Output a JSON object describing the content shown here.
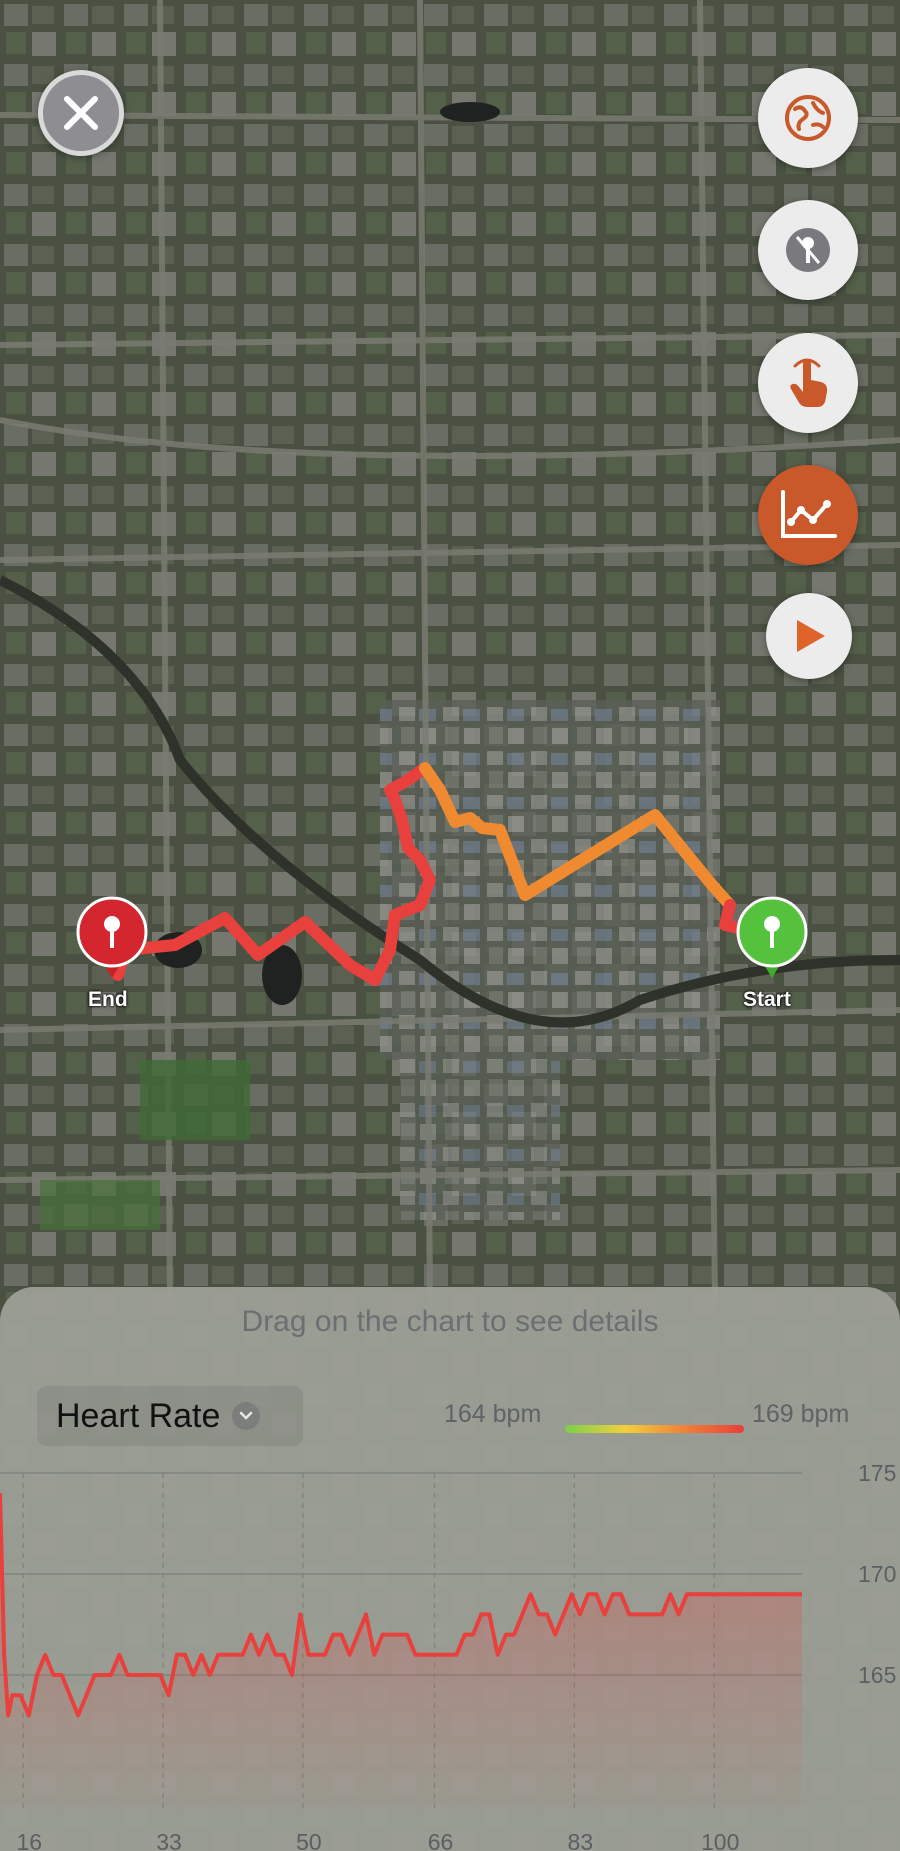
{
  "map": {
    "start_label": "Start",
    "end_label": "End",
    "route_colors": {
      "high": "#e8403d",
      "mid": "#f08a30",
      "low": "#7bd04a"
    }
  },
  "controls": {
    "close_icon": "close-icon",
    "globe_icon": "globe-icon",
    "pin_icon": "pin-hide-icon",
    "touch_icon": "touch-icon",
    "chart_icon": "chart-line-icon",
    "play_icon": "play-icon",
    "accent": "#c9582a"
  },
  "panel": {
    "hint": "Drag on the chart to see details",
    "metric": "Heart Rate",
    "legend_min": "164 bpm",
    "legend_max": "169 bpm"
  },
  "chart_data": {
    "type": "line",
    "metric": "Heart Rate",
    "unit": "bpm",
    "x_ticks": [
      16,
      33,
      50,
      66,
      83,
      100
    ],
    "y_ticks": [
      165,
      170,
      175
    ],
    "xlim": [
      10.5,
      108
    ],
    "ylim": [
      160.3,
      175
    ],
    "grid": true,
    "series": [
      {
        "color": "#e8403d",
        "x": [
          10.5,
          11,
          11.5,
          12,
          13,
          14,
          15,
          16,
          17,
          18,
          19,
          20,
          21,
          22,
          23,
          24,
          25,
          26,
          27,
          28,
          29,
          30,
          31,
          32,
          33,
          34,
          35,
          36,
          37,
          38,
          39,
          40,
          41,
          42,
          43,
          44,
          45,
          46,
          47,
          48,
          49,
          50,
          51,
          52,
          53,
          54,
          55,
          56,
          57,
          58,
          59,
          60,
          61,
          62,
          63,
          64,
          65,
          66,
          67,
          68,
          69,
          70,
          71,
          72,
          73,
          74,
          75,
          76,
          77,
          78,
          79,
          80,
          81,
          82,
          83,
          84,
          85,
          86,
          87,
          88,
          89,
          90,
          91,
          92,
          93,
          94,
          95,
          96,
          97,
          98,
          99,
          100,
          101,
          102,
          103,
          104,
          105,
          106,
          107,
          108
        ],
        "y": [
          174,
          166,
          163,
          164,
          164,
          163,
          165,
          166,
          165,
          165,
          164,
          163,
          164,
          165,
          165,
          165,
          166,
          165,
          165,
          165,
          165,
          165,
          164,
          166,
          166,
          165,
          166,
          165,
          166,
          166,
          166,
          166,
          167,
          166,
          167,
          166,
          166,
          165,
          168,
          166,
          166,
          166,
          167,
          167,
          166,
          167,
          168,
          166,
          167,
          167,
          167,
          167,
          166,
          166,
          166,
          166,
          166,
          166,
          167,
          167,
          168,
          168,
          166,
          167,
          167,
          168,
          169,
          168,
          168,
          167,
          168,
          169,
          168,
          169,
          169,
          168,
          169,
          169,
          168,
          168,
          168,
          168,
          168,
          169,
          168,
          169,
          169,
          169,
          169,
          169,
          169,
          169,
          169,
          169,
          169,
          169,
          169,
          169,
          169,
          169
        ]
      }
    ]
  }
}
